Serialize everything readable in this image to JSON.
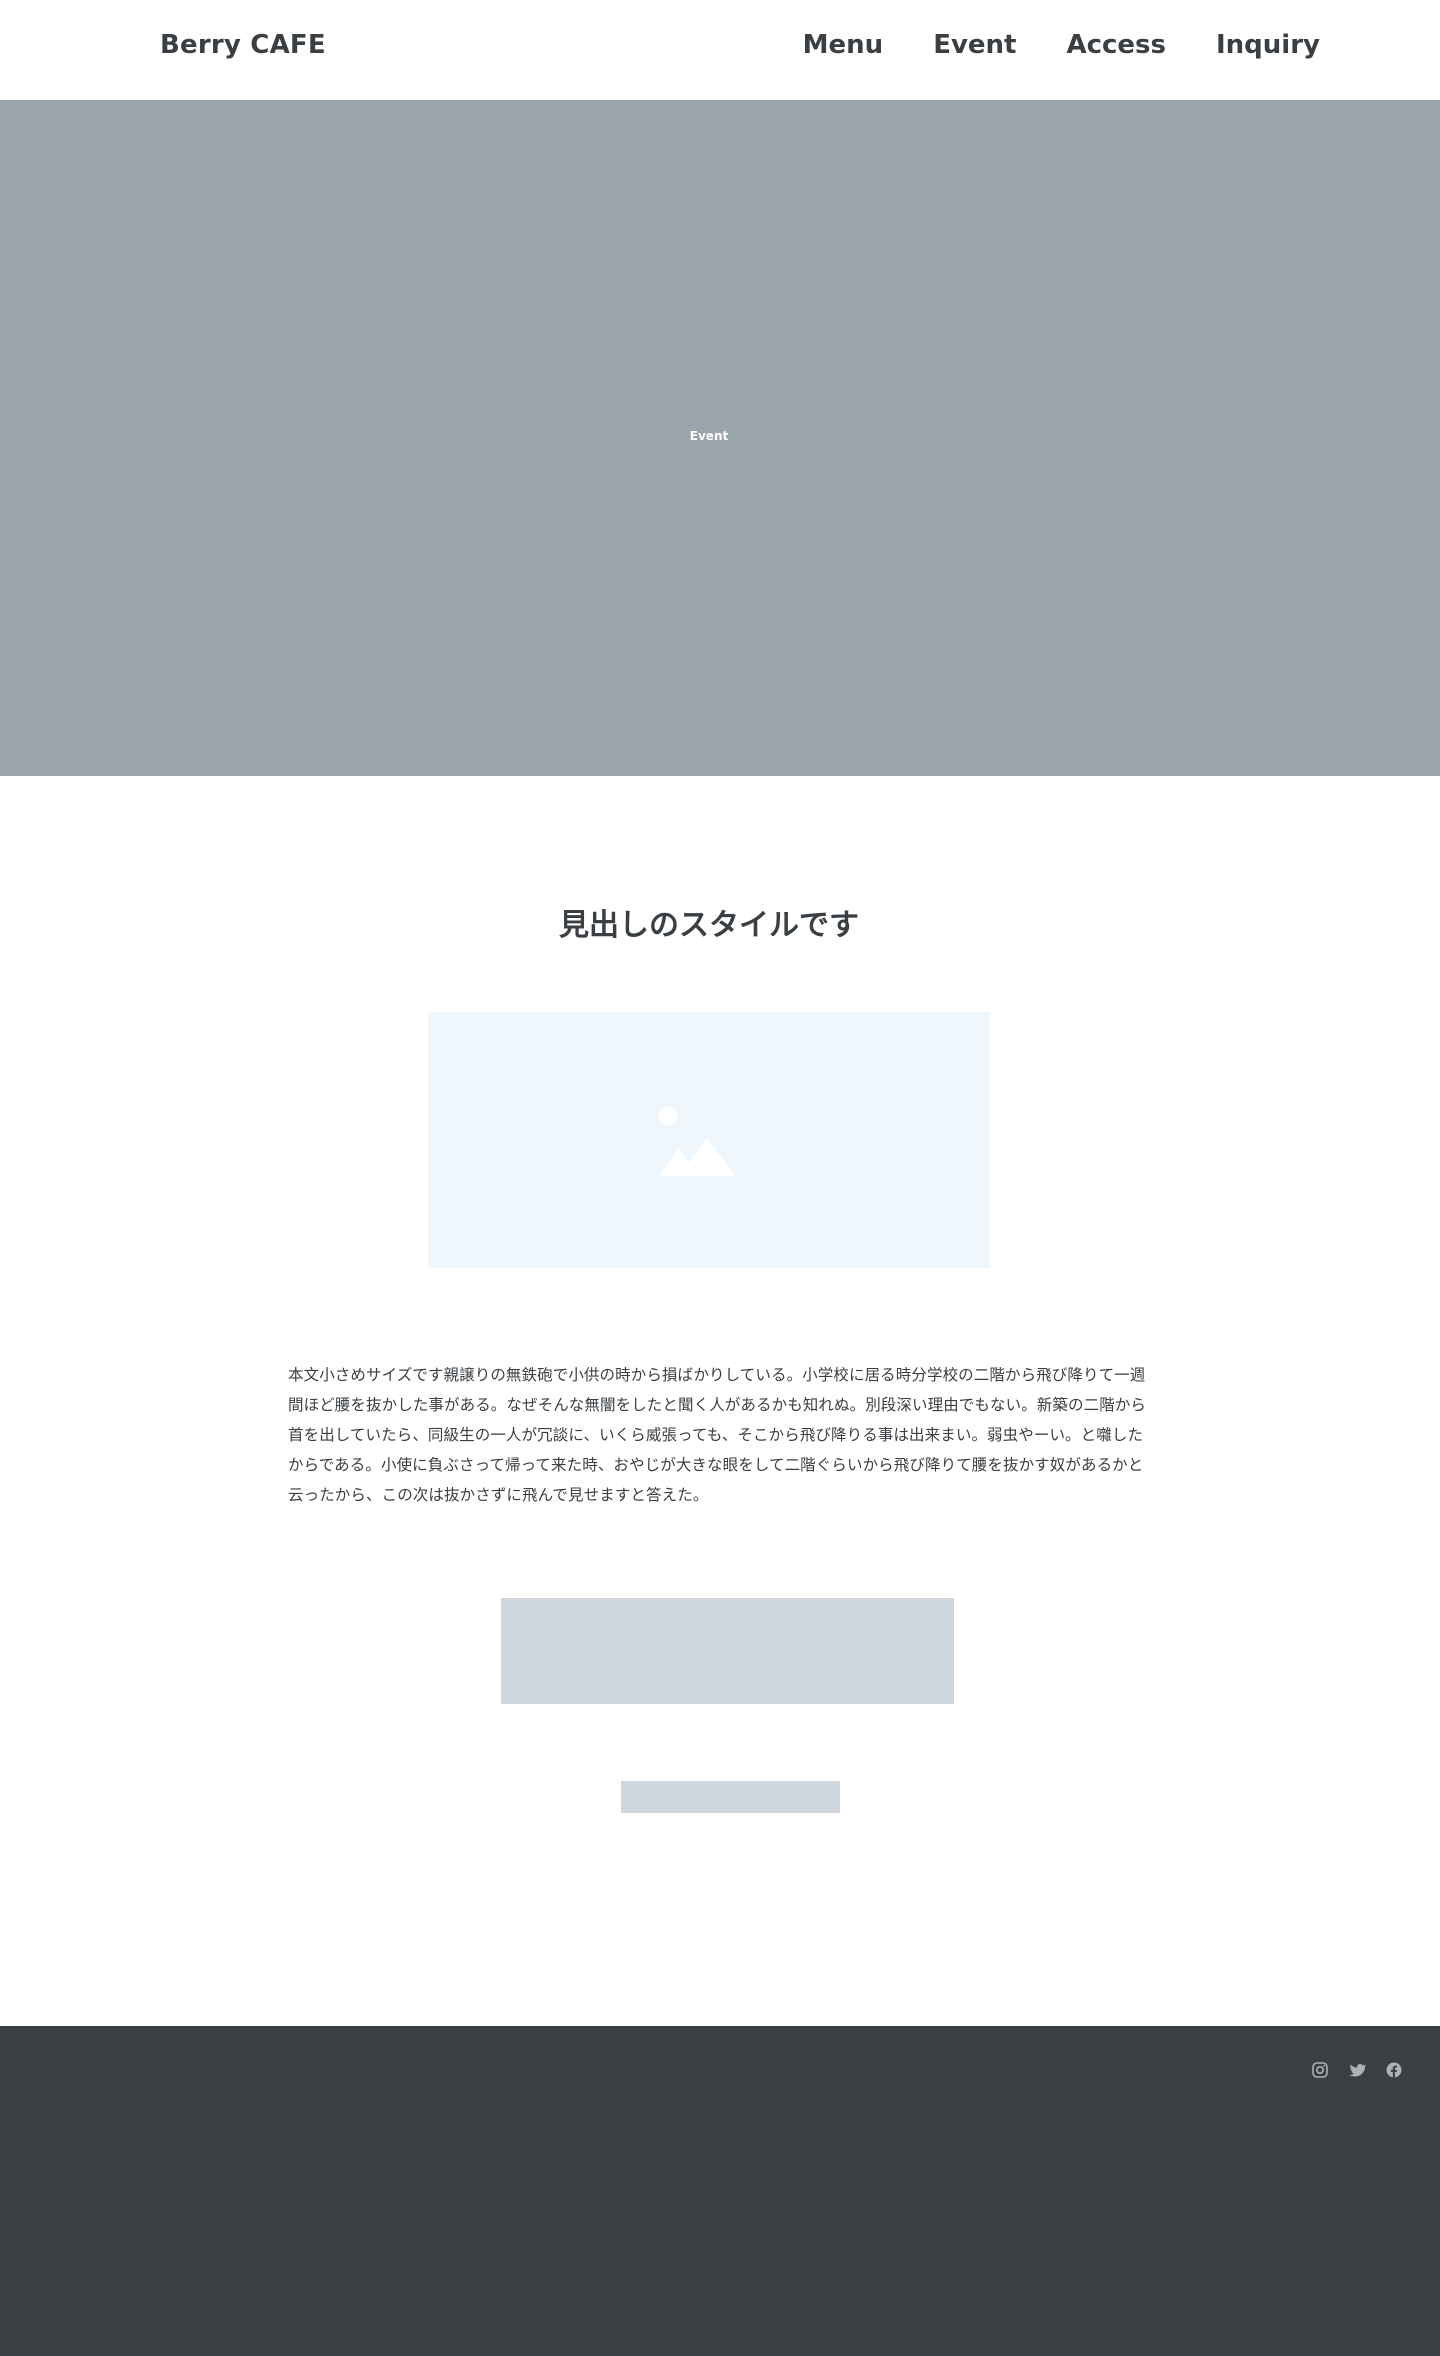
{
  "header": {
    "logo": "Berry CAFE",
    "nav": [
      {
        "label": "Menu"
      },
      {
        "label": "Event"
      },
      {
        "label": "Access"
      },
      {
        "label": "Inquiry"
      }
    ]
  },
  "hero": {
    "label": "Event",
    "background_color": "#9aa5ab"
  },
  "main": {
    "heading": "見出しのスタイルです",
    "image_icon": "image-placeholder-icon",
    "body_text": "本文小さめサイズです親譲りの無鉄砲で小供の時から損ばかりしている。小学校に居る時分学校の二階から飛び降りて一週間ほど腰を抜かした事がある。なぜそんな無闇をしたと聞く人があるかも知れぬ。別段深い理由でもない。新築の二階から首を出していたら、同級生の一人が冗談に、いくら威張っても、そこから飛び降りる事は出来まい。弱虫やーい。と囃したからである。小使に負ぶさって帰って来た時、おやじが大きな眼をして二階ぐらいから飛び降りて腰を抜かす奴があるかと云ったから、この次は抜かさずに飛んで見せますと答えた。"
  },
  "footer": {
    "background_color": "#3a3f43",
    "social_icons": [
      "instagram-icon",
      "twitter-icon",
      "facebook-icon"
    ]
  }
}
